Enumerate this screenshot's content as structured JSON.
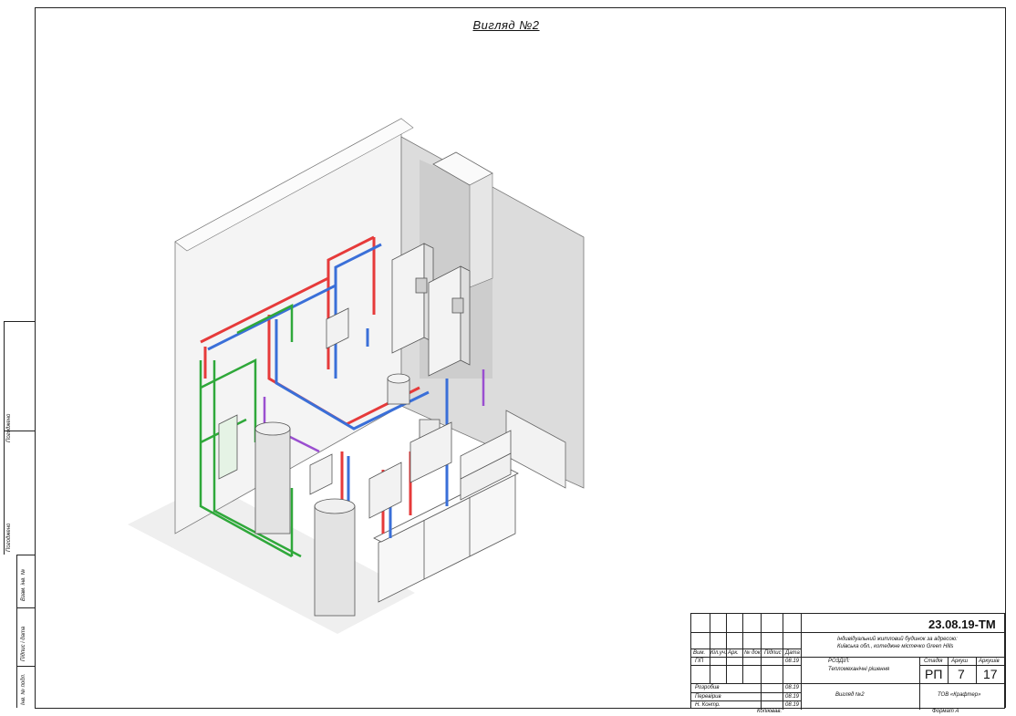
{
  "title": "Вигляд №2",
  "side_labels": {
    "inv_podl": "Інв. № подл.",
    "pidpys_data": "Підпис і дата",
    "vzam_inv": "Взам. інв. №",
    "pogodzheno_1": "Погоджено",
    "pogodzheno_2": "Погоджено"
  },
  "title_block": {
    "code": "23.08.19-ТМ",
    "project_line1": "Індивідуальний житловий будинок за адресою:",
    "project_line2": "Київська обл., котеджне містечко Green Hills",
    "columns": [
      "Вим.",
      "Кіл.уч.",
      "Арк.",
      "№ док.",
      "Підпис",
      "Дата"
    ],
    "section_label": "РОЗДІЛ:",
    "section_value": "Тепломеханічні рішення",
    "stage_header": "Стадія",
    "sheet_header": "Аркуш",
    "sheets_header": "Аркушів",
    "stage": "РП",
    "sheet": "7",
    "sheets": "17",
    "gip": "ГІП",
    "gip_date": "08.19",
    "roles": [
      "Розробив",
      "Перевірив",
      "Н. Контр."
    ],
    "role_dates": [
      "08.19",
      "08.19",
      "08.19"
    ],
    "drawing_name": "Вигляд №2",
    "company": "ТОВ «Крафтер»",
    "copied": "Копіював:",
    "format": "Формат А"
  },
  "colors": {
    "supply": "#e63a3a",
    "return": "#3a6fd8",
    "ground": "#2fa83a",
    "gas": "#9a4fd0",
    "wall": "#d9d9d9"
  }
}
